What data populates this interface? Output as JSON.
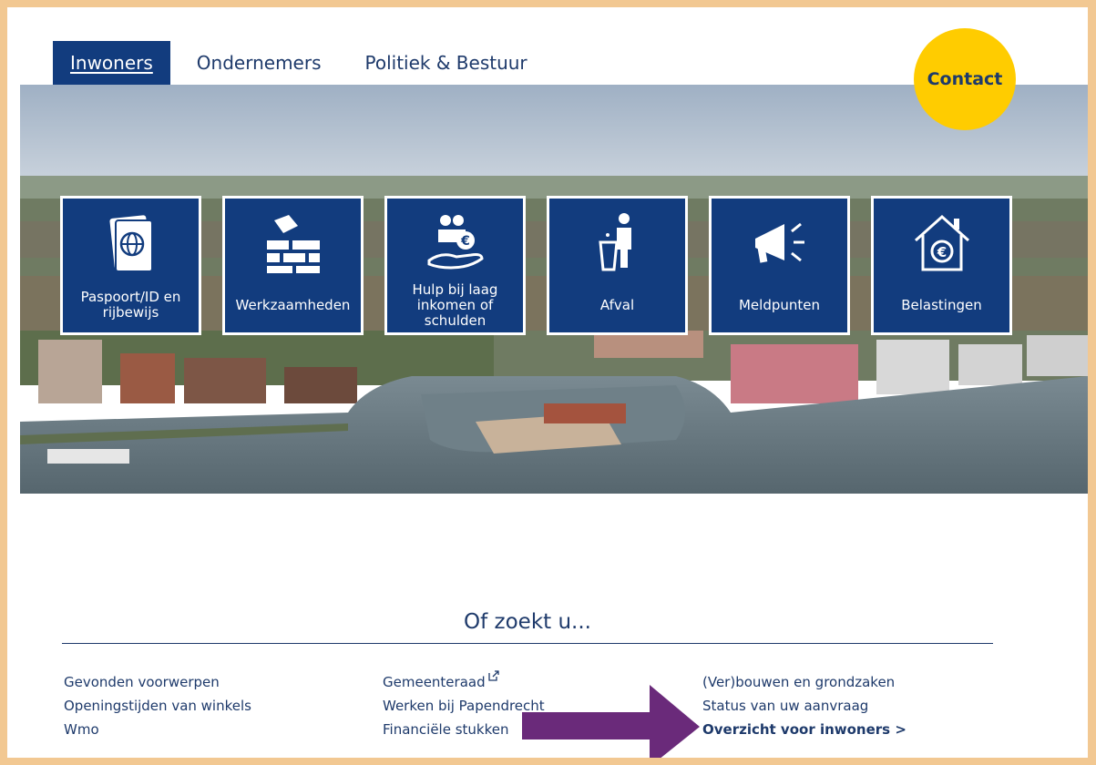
{
  "nav": {
    "tabs": [
      {
        "label": "Inwoners",
        "active": true
      },
      {
        "label": "Ondernemers",
        "active": false
      },
      {
        "label": "Politiek & Bestuur",
        "active": false
      }
    ],
    "contact_label": "Contact"
  },
  "colors": {
    "frame": "#f2c892",
    "brand_blue": "#123c7e",
    "contact_yellow": "#ffcc00",
    "annotation_arrow": "#6a2a7a"
  },
  "tiles": [
    {
      "label": "Paspoort/ID en rijbewijs",
      "icon": "passport-icon"
    },
    {
      "label": "Werkzaamheden",
      "icon": "construction-icon"
    },
    {
      "label": "Hulp bij laag inkomen of schulden",
      "icon": "financial-help-icon"
    },
    {
      "label": "Afval",
      "icon": "waste-icon"
    },
    {
      "label": "Meldpunten",
      "icon": "megaphone-icon"
    },
    {
      "label": "Belastingen",
      "icon": "house-euro-icon"
    }
  ],
  "of_zoekt": {
    "title": "Of zoekt u...",
    "col1": [
      "Gevonden voorwerpen",
      "Openingstijden van winkels",
      "Wmo"
    ],
    "col2": [
      "Gemeenteraad",
      "Werken bij Papendrecht",
      "Financiële stukken"
    ],
    "col3": [
      "(Ver)bouwen en grondzaken",
      "Status van uw aanvraag",
      "Overzicht voor inwoners >"
    ]
  }
}
